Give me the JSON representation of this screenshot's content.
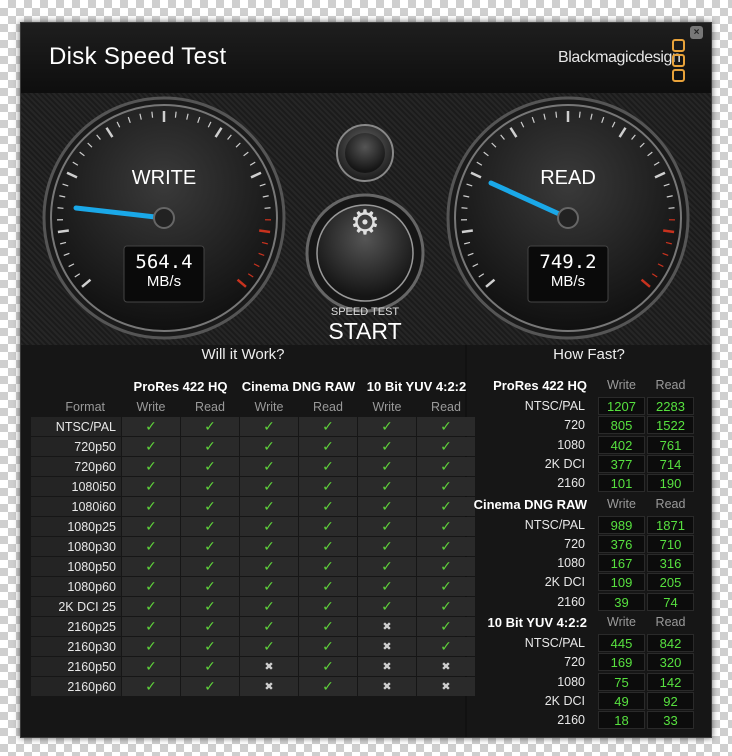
{
  "app": {
    "title": "Disk Speed Test",
    "brand": "Blackmagicdesign",
    "close_icon": "close-icon",
    "accent": "#e8a23a"
  },
  "gauges": {
    "write": {
      "label": "WRITE",
      "value": "564.4",
      "unit": "MB/s"
    },
    "read": {
      "label": "READ",
      "value": "749.2",
      "unit": "MB/s"
    },
    "settings_icon": "gear-icon",
    "start_small": "SPEED TEST",
    "start_big": "START",
    "needle_color": "#1aa8e8",
    "redline_color": "#c8321e"
  },
  "will_it_work": {
    "title": "Will it Work?",
    "groups": [
      "ProRes 422 HQ",
      "Cinema DNG RAW",
      "10 Bit YUV 4:2:2"
    ],
    "format_label": "Format",
    "sub_write": "Write",
    "sub_read": "Read",
    "check_symbol": "✓",
    "cross_symbol": "✖",
    "rows": [
      {
        "label": "NTSC/PAL",
        "cells": [
          "✓",
          "✓",
          "✓",
          "✓",
          "✓",
          "✓"
        ]
      },
      {
        "label": "720p50",
        "cells": [
          "✓",
          "✓",
          "✓",
          "✓",
          "✓",
          "✓"
        ]
      },
      {
        "label": "720p60",
        "cells": [
          "✓",
          "✓",
          "✓",
          "✓",
          "✓",
          "✓"
        ]
      },
      {
        "label": "1080i50",
        "cells": [
          "✓",
          "✓",
          "✓",
          "✓",
          "✓",
          "✓"
        ]
      },
      {
        "label": "1080i60",
        "cells": [
          "✓",
          "✓",
          "✓",
          "✓",
          "✓",
          "✓"
        ]
      },
      {
        "label": "1080p25",
        "cells": [
          "✓",
          "✓",
          "✓",
          "✓",
          "✓",
          "✓"
        ]
      },
      {
        "label": "1080p30",
        "cells": [
          "✓",
          "✓",
          "✓",
          "✓",
          "✓",
          "✓"
        ]
      },
      {
        "label": "1080p50",
        "cells": [
          "✓",
          "✓",
          "✓",
          "✓",
          "✓",
          "✓"
        ]
      },
      {
        "label": "1080p60",
        "cells": [
          "✓",
          "✓",
          "✓",
          "✓",
          "✓",
          "✓"
        ]
      },
      {
        "label": "2K DCI 25",
        "cells": [
          "✓",
          "✓",
          "✓",
          "✓",
          "✓",
          "✓"
        ]
      },
      {
        "label": "2160p25",
        "cells": [
          "✓",
          "✓",
          "✓",
          "✓",
          "✖",
          "✓"
        ]
      },
      {
        "label": "2160p30",
        "cells": [
          "✓",
          "✓",
          "✓",
          "✓",
          "✖",
          "✓"
        ]
      },
      {
        "label": "2160p50",
        "cells": [
          "✓",
          "✓",
          "✖",
          "✓",
          "✖",
          "✖"
        ]
      },
      {
        "label": "2160p60",
        "cells": [
          "✓",
          "✓",
          "✖",
          "✓",
          "✖",
          "✖"
        ]
      }
    ]
  },
  "how_fast": {
    "title": "How Fast?",
    "sub_write": "Write",
    "sub_read": "Read",
    "groups": [
      {
        "name": "ProRes 422 HQ",
        "rows": [
          {
            "label": "NTSC/PAL",
            "write": "1207",
            "read": "2283"
          },
          {
            "label": "720",
            "write": "805",
            "read": "1522"
          },
          {
            "label": "1080",
            "write": "402",
            "read": "761"
          },
          {
            "label": "2K DCI",
            "write": "377",
            "read": "714"
          },
          {
            "label": "2160",
            "write": "101",
            "read": "190"
          }
        ]
      },
      {
        "name": "Cinema DNG RAW",
        "rows": [
          {
            "label": "NTSC/PAL",
            "write": "989",
            "read": "1871"
          },
          {
            "label": "720",
            "write": "376",
            "read": "710"
          },
          {
            "label": "1080",
            "write": "167",
            "read": "316"
          },
          {
            "label": "2K DCI",
            "write": "109",
            "read": "205"
          },
          {
            "label": "2160",
            "write": "39",
            "read": "74"
          }
        ]
      },
      {
        "name": "10 Bit YUV 4:2:2",
        "rows": [
          {
            "label": "NTSC/PAL",
            "write": "445",
            "read": "842"
          },
          {
            "label": "720",
            "write": "169",
            "read": "320"
          },
          {
            "label": "1080",
            "write": "75",
            "read": "142"
          },
          {
            "label": "2K DCI",
            "write": "49",
            "read": "92"
          },
          {
            "label": "2160",
            "write": "18",
            "read": "33"
          }
        ]
      }
    ]
  }
}
